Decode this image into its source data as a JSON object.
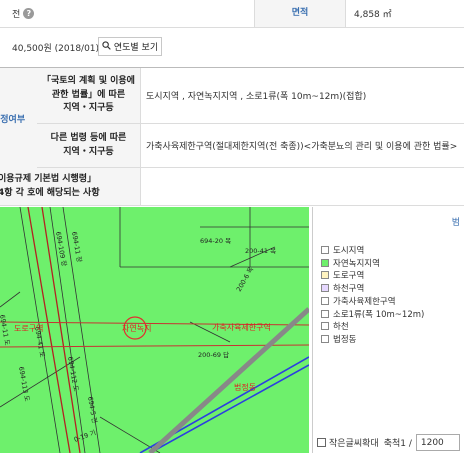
{
  "top_row": {
    "left_label": "전",
    "area_label": "면적",
    "area_value": "4,858 ㎡"
  },
  "price_row": {
    "price": "40,500원 (2018/01)",
    "year_button": "연도별 보기"
  },
  "zoning": {
    "side_label": "지정여부",
    "law1_label_line1": "「국토의 계획 및 이용에",
    "law1_label_line2": "관한 법률」에 따른",
    "law1_label_line3": "지역・지구등",
    "law1_value": "도시지역 , 자연녹지지역 , 소로1류(폭 10m~12m)(접합)",
    "law2_label_line1": "다른 법령 등에 따른",
    "law2_label_line2": "지역・지구등",
    "law2_value": "가축사육제한구역(절대제한지역(전 축종))<가축분뇨의 관리 및 이용에 관한 법률>"
  },
  "enforcement": {
    "line1": "이용규제 기본법 시행령」",
    "line2": "4항 각 호에 해당되는 사항"
  },
  "map": {
    "labels": [
      "694-20 목",
      "200-41 목",
      "200-6 목",
      "200-69 답",
      "694-109 장",
      "694-11 장",
      "694-41 도",
      "694-112 도",
      "694-113 도",
      "694-11 도",
      "694-5 전",
      "0-19 기"
    ],
    "overlay_labels": [
      "도로구역",
      "자연녹지지역",
      "가축사육제한구역",
      "법정동"
    ]
  },
  "legend": {
    "header": "범",
    "items": [
      {
        "label": "도시지역",
        "color": "#ffffff"
      },
      {
        "label": "자연녹지지역",
        "color": "#6ef06c"
      },
      {
        "label": "도로구역",
        "color": "#fff3c0"
      },
      {
        "label": "하천구역",
        "color": "#e6d8ff"
      },
      {
        "label": "가축사육제한구역",
        "color": "#ffffff"
      },
      {
        "label": "소로1류(폭 10m~12m)",
        "color": "#ffffff"
      },
      {
        "label": "하천",
        "color": "#ffffff"
      },
      {
        "label": "법정동",
        "color": "#ffffff"
      }
    ],
    "small_print_label": "작은글씨확대",
    "scale_label": "축척1 /",
    "scale_value": "1200"
  }
}
